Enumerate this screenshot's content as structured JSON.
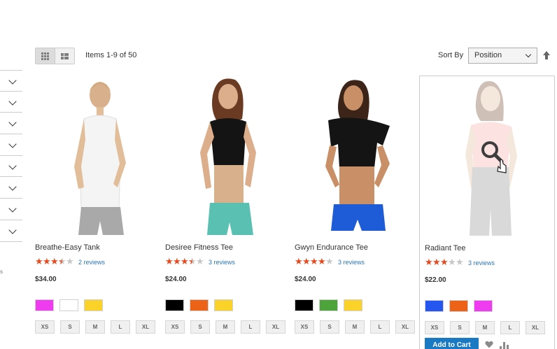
{
  "toolbar": {
    "amount": "Items 1-9 of 50",
    "sort_label": "Sort By",
    "sort_selected": "Position",
    "grid_icon": "grid-view-icon",
    "list_icon": "list-view-icon",
    "sort_direction_icon": "arrow-up-icon"
  },
  "sidebar": {
    "filter_count": 8,
    "chevron_icon": "chevron-down-icon",
    "fragment": "s"
  },
  "products": [
    {
      "name": "Breathe-Easy Tank",
      "rating": 3.5,
      "reviews": "2 reviews",
      "price": "$34.00",
      "colors": [
        "#f03cf0",
        "#ffffff",
        "#fbd328"
      ],
      "sizes": [
        "XS",
        "S",
        "M",
        "L",
        "XL"
      ]
    },
    {
      "name": "Desiree Fitness Tee",
      "rating": 3.5,
      "reviews": "3 reviews",
      "price": "$24.00",
      "colors": [
        "#000000",
        "#ec6317",
        "#fbd328"
      ],
      "sizes": [
        "XS",
        "S",
        "M",
        "L",
        "XL"
      ]
    },
    {
      "name": "Gwyn Endurance Tee",
      "rating": 4,
      "reviews": "3 reviews",
      "price": "$24.00",
      "colors": [
        "#000000",
        "#4ca43a",
        "#fbd328"
      ],
      "sizes": [
        "XS",
        "S",
        "M",
        "L",
        "XL"
      ]
    },
    {
      "name": "Radiant Tee",
      "rating": 3,
      "reviews": "3 reviews",
      "price": "$22.00",
      "colors": [
        "#2557f0",
        "#ec6317",
        "#f03cf0"
      ],
      "sizes": [
        "XS",
        "S",
        "M",
        "L",
        "XL"
      ],
      "add_to_cart": "Add to Cart",
      "wishlist_icon": "heart-icon",
      "compare_icon": "compare-bars-icon",
      "hover_icon": "magnifier-icon"
    }
  ],
  "colors": {
    "accent": "#1979c3",
    "star": "#e64a1e",
    "link": "#2c75b7"
  }
}
